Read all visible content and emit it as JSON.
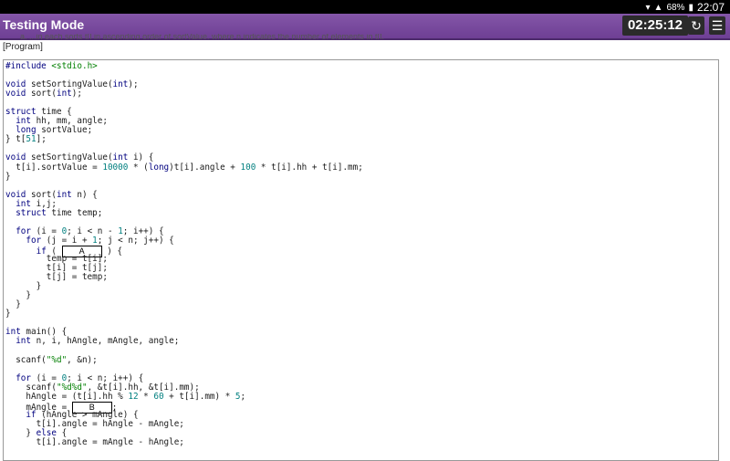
{
  "statusbar": {
    "battery": "68%",
    "clock": "22:07"
  },
  "titlebar": {
    "title": "Testing Mode",
    "timer": "02:25:12"
  },
  "instruction_cut": "a. ...in each sorts t[] in ascending order of sortValue, where n indicates the number of elements in t[].",
  "program_label": "[Program]",
  "code": {
    "blank_a": "A",
    "blank_b": "B",
    "lines": [
      "#include <stdio.h>",
      "",
      "void setSortingValue(int);",
      "void sort(int);",
      "",
      "struct time {",
      "  int hh, mm, angle;",
      "  long sortValue;",
      "} t[51];",
      "",
      "void setSortingValue(int i) {",
      "  t[i].sortValue = 10000 * (long)t[i].angle + 100 * t[i].hh + t[i].mm;",
      "}",
      "",
      "void sort(int n) {",
      "  int i,j;",
      "  struct time temp;",
      "",
      "  for (i = 0; i < n - 1; i++) {",
      "    for (j = i + 1; j < n; j++) {",
      "      if ( @A ) {",
      "        temp = t[i];",
      "        t[i] = t[j];",
      "        t[j] = temp;",
      "      }",
      "    }",
      "  }",
      "}",
      "",
      "int main() {",
      "  int n, i, hAngle, mAngle, angle;",
      "",
      "  scanf(\"%d\", &n);",
      "",
      "  for (i = 0; i < n; i++) {",
      "    scanf(\"%d%d\", &t[i].hh, &t[i].mm);",
      "    hAngle = (t[i].hh % 12 * 60 + t[i].mm) * 5;",
      "    mAngle = @B;",
      "    if (hAngle > mAngle) {",
      "      t[i].angle = hAngle - mAngle;",
      "    } else {",
      "      t[i].angle = mAngle - hAngle;"
    ]
  }
}
